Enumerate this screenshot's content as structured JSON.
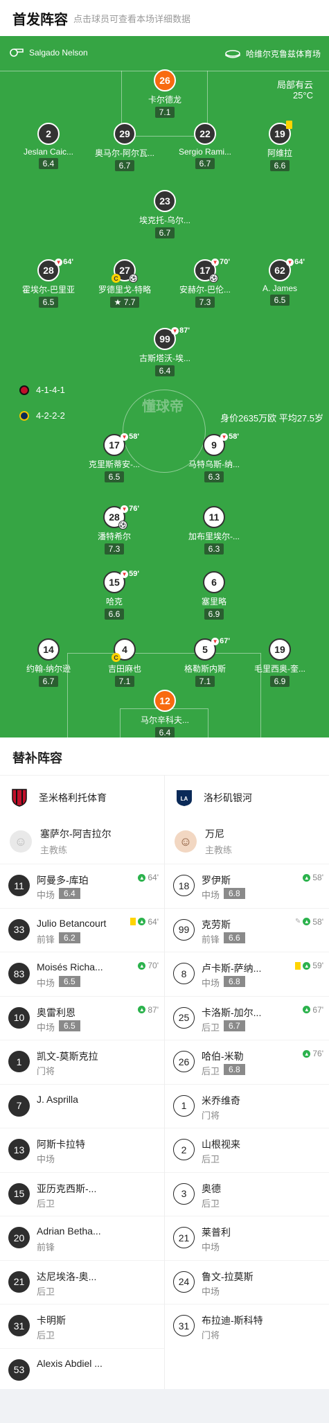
{
  "header": {
    "title": "首发阵容",
    "subtitle": "点击球员可查看本场详细数据"
  },
  "pitch": {
    "referee": "Salgado Nelson",
    "stadium": "哈维尔克鲁兹体育场",
    "weather": "局部有云",
    "temperature": "25°C",
    "home_formation": "4-1-4-1",
    "away_formation": "4-2-2-2",
    "away_value": "身价2635万欧 平均27.5岁",
    "watermark": "懂球帝",
    "colors": {
      "pitch": "#36a544",
      "gk": "#f86a10"
    },
    "home_players": [
      {
        "num": "26",
        "name": "卡尔德龙",
        "rating": "7.1",
        "gk": true
      },
      {
        "num": "2",
        "name": "Jeslan Caic...",
        "rating": "6.4"
      },
      {
        "num": "29",
        "name": "奥马尔-阿尔瓦...",
        "rating": "6.7"
      },
      {
        "num": "22",
        "name": "Sergio Rami...",
        "rating": "6.7"
      },
      {
        "num": "19",
        "name": "阿维拉",
        "rating": "6.6",
        "yellow": true
      },
      {
        "num": "23",
        "name": "埃克托-乌尔...",
        "rating": "6.7"
      },
      {
        "num": "28",
        "name": "霍埃尔-巴里亚",
        "rating": "6.5",
        "sub": "64'"
      },
      {
        "num": "27",
        "name": "罗德里戈-特略",
        "rating": "7.7",
        "captain": true,
        "goal": true,
        "star": true
      },
      {
        "num": "17",
        "name": "安赫尔-巴伦...",
        "rating": "7.3",
        "sub": "70'",
        "goal": true
      },
      {
        "num": "62",
        "name": "A. James",
        "rating": "6.5",
        "sub": "64'"
      },
      {
        "num": "99",
        "name": "古斯塔沃-埃...",
        "rating": "6.4",
        "sub": "87'"
      }
    ],
    "away_players": [
      {
        "num": "17",
        "name": "克里斯蒂安-...",
        "rating": "6.5",
        "sub": "58'"
      },
      {
        "num": "9",
        "name": "马特乌斯-纳...",
        "rating": "6.3",
        "sub": "58'"
      },
      {
        "num": "28",
        "name": "潘特希尔",
        "rating": "7.3",
        "sub": "76'",
        "goal": true
      },
      {
        "num": "11",
        "name": "加布里埃尔-...",
        "rating": "6.3"
      },
      {
        "num": "15",
        "name": "哈克",
        "rating": "6.6",
        "sub": "59'"
      },
      {
        "num": "6",
        "name": "塞里略",
        "rating": "6.9"
      },
      {
        "num": "14",
        "name": "约翰-纳尔逊",
        "rating": "6.7"
      },
      {
        "num": "4",
        "name": "吉田麻也",
        "rating": "7.1",
        "captain": true
      },
      {
        "num": "5",
        "name": "格勒斯内斯",
        "rating": "7.1",
        "sub": "67'"
      },
      {
        "num": "19",
        "name": "毛里西奥-奎...",
        "rating": "6.9"
      },
      {
        "num": "12",
        "name": "马尔辛科夫...",
        "rating": "6.4",
        "gk": true
      }
    ]
  },
  "subs": {
    "title": "替补阵容",
    "home": {
      "team": "圣米格利托体育",
      "coach": "塞萨尔-阿吉拉尔",
      "coach_role": "主教练",
      "players": [
        {
          "num": "11",
          "name": "阿曼多-库珀",
          "pos": "中场",
          "rating": "6.4",
          "in": "64'"
        },
        {
          "num": "33",
          "name": "Julio Betancourt",
          "pos": "前锋",
          "rating": "6.2",
          "in": "64'",
          "yellow": true
        },
        {
          "num": "83",
          "name": "Moisés Richa...",
          "pos": "中场",
          "rating": "6.5",
          "in": "70'"
        },
        {
          "num": "10",
          "name": "奥雷利恩",
          "pos": "中场",
          "rating": "6.5",
          "in": "87'"
        },
        {
          "num": "1",
          "name": "凯文-莫斯克拉",
          "pos": "门将"
        },
        {
          "num": "7",
          "name": "J. Asprilla",
          "pos": ""
        },
        {
          "num": "13",
          "name": "阿斯卡拉特",
          "pos": "中场"
        },
        {
          "num": "15",
          "name": "亚历克西斯-...",
          "pos": "后卫"
        },
        {
          "num": "20",
          "name": "Adrian Betha...",
          "pos": "前锋"
        },
        {
          "num": "21",
          "name": "达尼埃洛-奥...",
          "pos": "后卫"
        },
        {
          "num": "31",
          "name": "卡明斯",
          "pos": "后卫"
        },
        {
          "num": "53",
          "name": "Alexis Abdiel ...",
          "pos": ""
        }
      ]
    },
    "away": {
      "team": "洛杉矶银河",
      "coach": "万尼",
      "coach_role": "主教练",
      "players": [
        {
          "num": "18",
          "name": "罗伊斯",
          "pos": "中场",
          "rating": "6.8",
          "in": "58'"
        },
        {
          "num": "99",
          "name": "克劳斯",
          "pos": "前锋",
          "rating": "6.6",
          "in": "58'",
          "boot": true
        },
        {
          "num": "8",
          "name": "卢卡斯-萨纳...",
          "pos": "中场",
          "rating": "6.8",
          "in": "59'",
          "yellow": true
        },
        {
          "num": "25",
          "name": "卡洛斯-加尔...",
          "pos": "后卫",
          "rating": "6.7",
          "in": "67'"
        },
        {
          "num": "26",
          "name": "哈伯-米勒",
          "pos": "后卫",
          "rating": "6.8",
          "in": "76'"
        },
        {
          "num": "1",
          "name": "米乔维奇",
          "pos": "门将"
        },
        {
          "num": "2",
          "name": "山根视来",
          "pos": "后卫"
        },
        {
          "num": "3",
          "name": "奥德",
          "pos": "后卫"
        },
        {
          "num": "21",
          "name": "莱普利",
          "pos": "中场"
        },
        {
          "num": "24",
          "name": "鲁文-拉莫斯",
          "pos": "中场"
        },
        {
          "num": "31",
          "name": "布拉迪-斯科特",
          "pos": "门将"
        }
      ]
    }
  }
}
